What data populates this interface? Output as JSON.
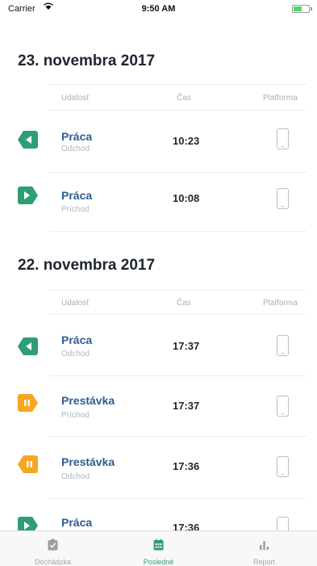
{
  "status_bar": {
    "carrier": "Carrier",
    "time": "9:50 AM"
  },
  "columns": {
    "event": "Udalosť",
    "time": "Čas",
    "platform": "Platforma"
  },
  "days": [
    {
      "title": "23. novembra 2017",
      "events": [
        {
          "type": "out",
          "title": "Práca",
          "subtitle": "Odchod",
          "time": "10:23",
          "icon": "phone-icon"
        },
        {
          "type": "in",
          "title": "Práca",
          "subtitle": "Príchod",
          "time": "10:08",
          "icon": "phone-icon"
        }
      ]
    },
    {
      "title": "22. novembra 2017",
      "events": [
        {
          "type": "out",
          "title": "Práca",
          "subtitle": "Odchod",
          "time": "17:37",
          "icon": "phone-icon"
        },
        {
          "type": "pause-in",
          "title": "Prestávka",
          "subtitle": "Príchod",
          "time": "17:37",
          "icon": "phone-icon"
        },
        {
          "type": "pause-out",
          "title": "Prestávka",
          "subtitle": "Odchod",
          "time": "17:36",
          "icon": "phone-icon"
        },
        {
          "type": "in",
          "title": "Práca",
          "subtitle": "",
          "time": "17:36",
          "icon": "phone-icon"
        }
      ]
    }
  ],
  "colors": {
    "green": "#2e9e74",
    "orange": "#f5a623",
    "title_blue": "#2f5d8f"
  },
  "tabs": [
    {
      "label": "Dochádzka",
      "icon": "clipboard-check-icon",
      "active": false
    },
    {
      "label": "Posledné",
      "icon": "calendar-icon",
      "active": true
    },
    {
      "label": "Report",
      "icon": "bar-chart-icon",
      "active": false
    }
  ]
}
